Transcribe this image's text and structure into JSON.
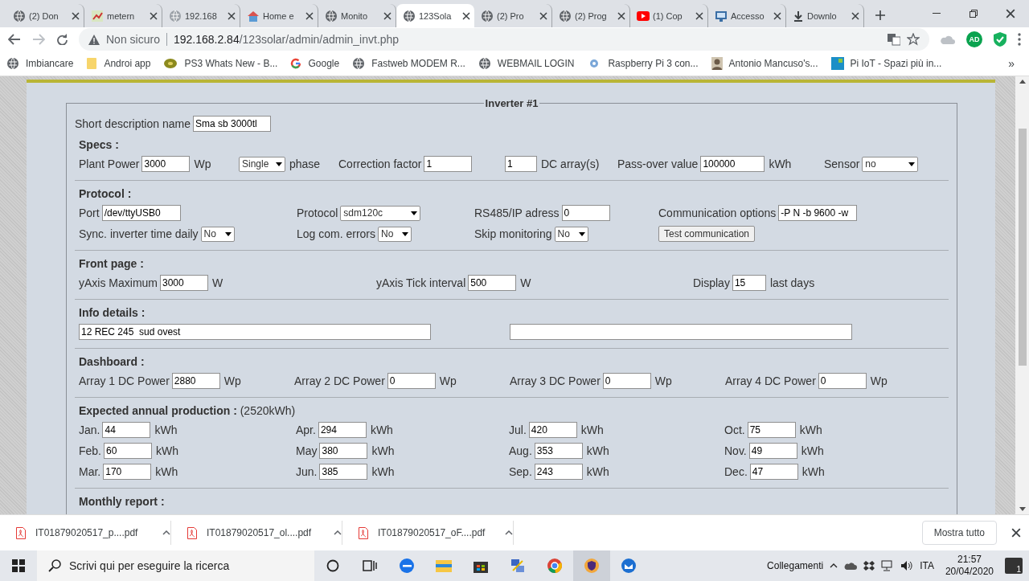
{
  "browser": {
    "tabs": [
      {
        "title": "(2) Don",
        "selected": false
      },
      {
        "title": "metern",
        "selected": false
      },
      {
        "title": "192.168",
        "selected": false
      },
      {
        "title": "Home e",
        "selected": false
      },
      {
        "title": "Monito",
        "selected": false
      },
      {
        "title": "123Sola",
        "selected": true
      },
      {
        "title": "(2) Pro",
        "selected": false
      },
      {
        "title": "(2) Prog",
        "selected": false
      },
      {
        "title": "(1) Cop",
        "selected": false
      },
      {
        "title": "Accesso",
        "selected": false
      },
      {
        "title": "Downlo",
        "selected": false
      }
    ],
    "url": {
      "security": "Non sicuro",
      "host": "192.168.2.84",
      "path": "/123solar/admin/admin_invt.php"
    },
    "extension_badge": "AD",
    "bookmarks": [
      "Imbiancare",
      "Androi app",
      "PS3 Whats New - B...",
      "Google",
      "Fastweb MODEM R...",
      "WEBMAIL LOGIN",
      "Raspberry Pi 3 con...",
      "Antonio Mancuso's...",
      "Pi IoT - Spazi più in..."
    ],
    "bookmarks_more": "»"
  },
  "form": {
    "legend": "Inverter #1",
    "short_description": {
      "label": "Short description name",
      "value": "Sma sb 3000tl"
    },
    "sections": [
      {
        "title": "Specs :",
        "rows": [
          [
            {
              "label": "Plant Power",
              "field": {
                "kind": "input",
                "value": "3000"
              },
              "unit": "Wp"
            },
            {
              "field": {
                "kind": "select",
                "value": "Single"
              },
              "unit": "phase"
            },
            {
              "label": "Correction factor",
              "field": {
                "kind": "input",
                "value": "1"
              }
            },
            {
              "field": {
                "kind": "input",
                "value": "1"
              },
              "unit": "DC array(s)"
            },
            {
              "label": "Pass-over value",
              "field": {
                "kind": "input",
                "value": "100000"
              },
              "unit": "kWh"
            },
            {
              "label": "Sensor",
              "field": {
                "kind": "select",
                "value": "no"
              }
            }
          ]
        ]
      },
      {
        "title": "Protocol :",
        "rows": [
          [
            {
              "label": "Port",
              "field": {
                "kind": "input",
                "value": "/dev/ttyUSB0"
              }
            },
            {
              "label": "Protocol",
              "field": {
                "kind": "select",
                "value": "sdm120c"
              }
            },
            {
              "label": "RS485/IP adress",
              "field": {
                "kind": "input",
                "value": "0"
              }
            },
            {
              "label": "Communication options",
              "field": {
                "kind": "input",
                "value": "-P N -b 9600 -w"
              }
            }
          ],
          [
            {
              "label": "Sync. inverter time daily",
              "field": {
                "kind": "select",
                "value": "No"
              }
            },
            {
              "label": "Log com. errors",
              "field": {
                "kind": "select",
                "value": "No"
              }
            },
            {
              "label": "Skip monitoring",
              "field": {
                "kind": "select",
                "value": "No"
              }
            },
            {
              "field": {
                "kind": "button",
                "value": "Test communication"
              }
            }
          ]
        ]
      },
      {
        "title": "Front page :",
        "rows": [
          [
            {
              "label": "yAxis Maximum",
              "field": {
                "kind": "input",
                "value": "3000"
              },
              "unit": "W"
            },
            {
              "label": "yAxis Tick interval",
              "field": {
                "kind": "input",
                "value": "500"
              },
              "unit": "W"
            },
            {
              "label": "Display",
              "field": {
                "kind": "input",
                "value": "15"
              },
              "unit": "last days"
            }
          ]
        ]
      },
      {
        "title": "Info details :",
        "rows": [
          [
            {
              "field": {
                "kind": "input",
                "value": "12 REC 245  sud ovest"
              }
            },
            {
              "field": {
                "kind": "input"
              }
            }
          ]
        ]
      },
      {
        "title": "Dashboard :",
        "rows": [
          [
            {
              "label": "Array 1 DC Power",
              "field": {
                "kind": "input",
                "value": "2880"
              },
              "unit": "Wp"
            },
            {
              "label": "Array 2 DC Power",
              "field": {
                "kind": "input",
                "value": "0"
              },
              "unit": "Wp"
            },
            {
              "label": "Array 3 DC Power",
              "field": {
                "kind": "input",
                "value": "0"
              },
              "unit": "Wp"
            },
            {
              "label": "Array 4 DC Power",
              "field": {
                "kind": "input",
                "value": "0"
              },
              "unit": "Wp"
            }
          ]
        ]
      },
      {
        "title": "Expected annual production :",
        "note": "(2520kWh)",
        "rows": [
          [
            {
              "label": "Jan.",
              "field": {
                "kind": "input",
                "value": "44"
              },
              "unit": "kWh"
            },
            {
              "label": "Apr.",
              "field": {
                "kind": "input",
                "value": "294"
              },
              "unit": "kWh"
            },
            {
              "label": "Jul.",
              "field": {
                "kind": "input",
                "value": "420"
              },
              "unit": "kWh"
            },
            {
              "label": "Oct.",
              "field": {
                "kind": "input",
                "value": "75"
              },
              "unit": "kWh"
            }
          ],
          [
            {
              "label": "Feb.",
              "field": {
                "kind": "input",
                "value": "60"
              },
              "unit": "kWh"
            },
            {
              "label": "May",
              "field": {
                "kind": "input",
                "value": "380"
              },
              "unit": "kWh"
            },
            {
              "label": "Aug.",
              "field": {
                "kind": "input",
                "value": "353"
              },
              "unit": "kWh"
            },
            {
              "label": "Nov.",
              "field": {
                "kind": "input",
                "value": "49"
              },
              "unit": "kWh"
            }
          ],
          [
            {
              "label": "Mar.",
              "field": {
                "kind": "input",
                "value": "170"
              },
              "unit": "kWh"
            },
            {
              "label": "Jun.",
              "field": {
                "kind": "input",
                "value": "385"
              },
              "unit": "kWh"
            },
            {
              "label": "Sep.",
              "field": {
                "kind": "input",
                "value": "243"
              },
              "unit": "kWh"
            },
            {
              "label": "Dec.",
              "field": {
                "kind": "input",
                "value": "47"
              },
              "unit": "kWh"
            }
          ]
        ]
      },
      {
        "title": "Monthly report :"
      }
    ]
  },
  "downloads": {
    "files": [
      "IT01879020517_p....pdf",
      "IT01879020517_ol....pdf",
      "IT01879020517_oF....pdf"
    ],
    "show_all": "Mostra tutto"
  },
  "taskbar": {
    "search_placeholder": "Scrivi qui per eseguire la ricerca",
    "links": "Collegamenti",
    "language": "ITA",
    "time": "21:57",
    "date": "20/04/2020",
    "notifications": "1"
  }
}
